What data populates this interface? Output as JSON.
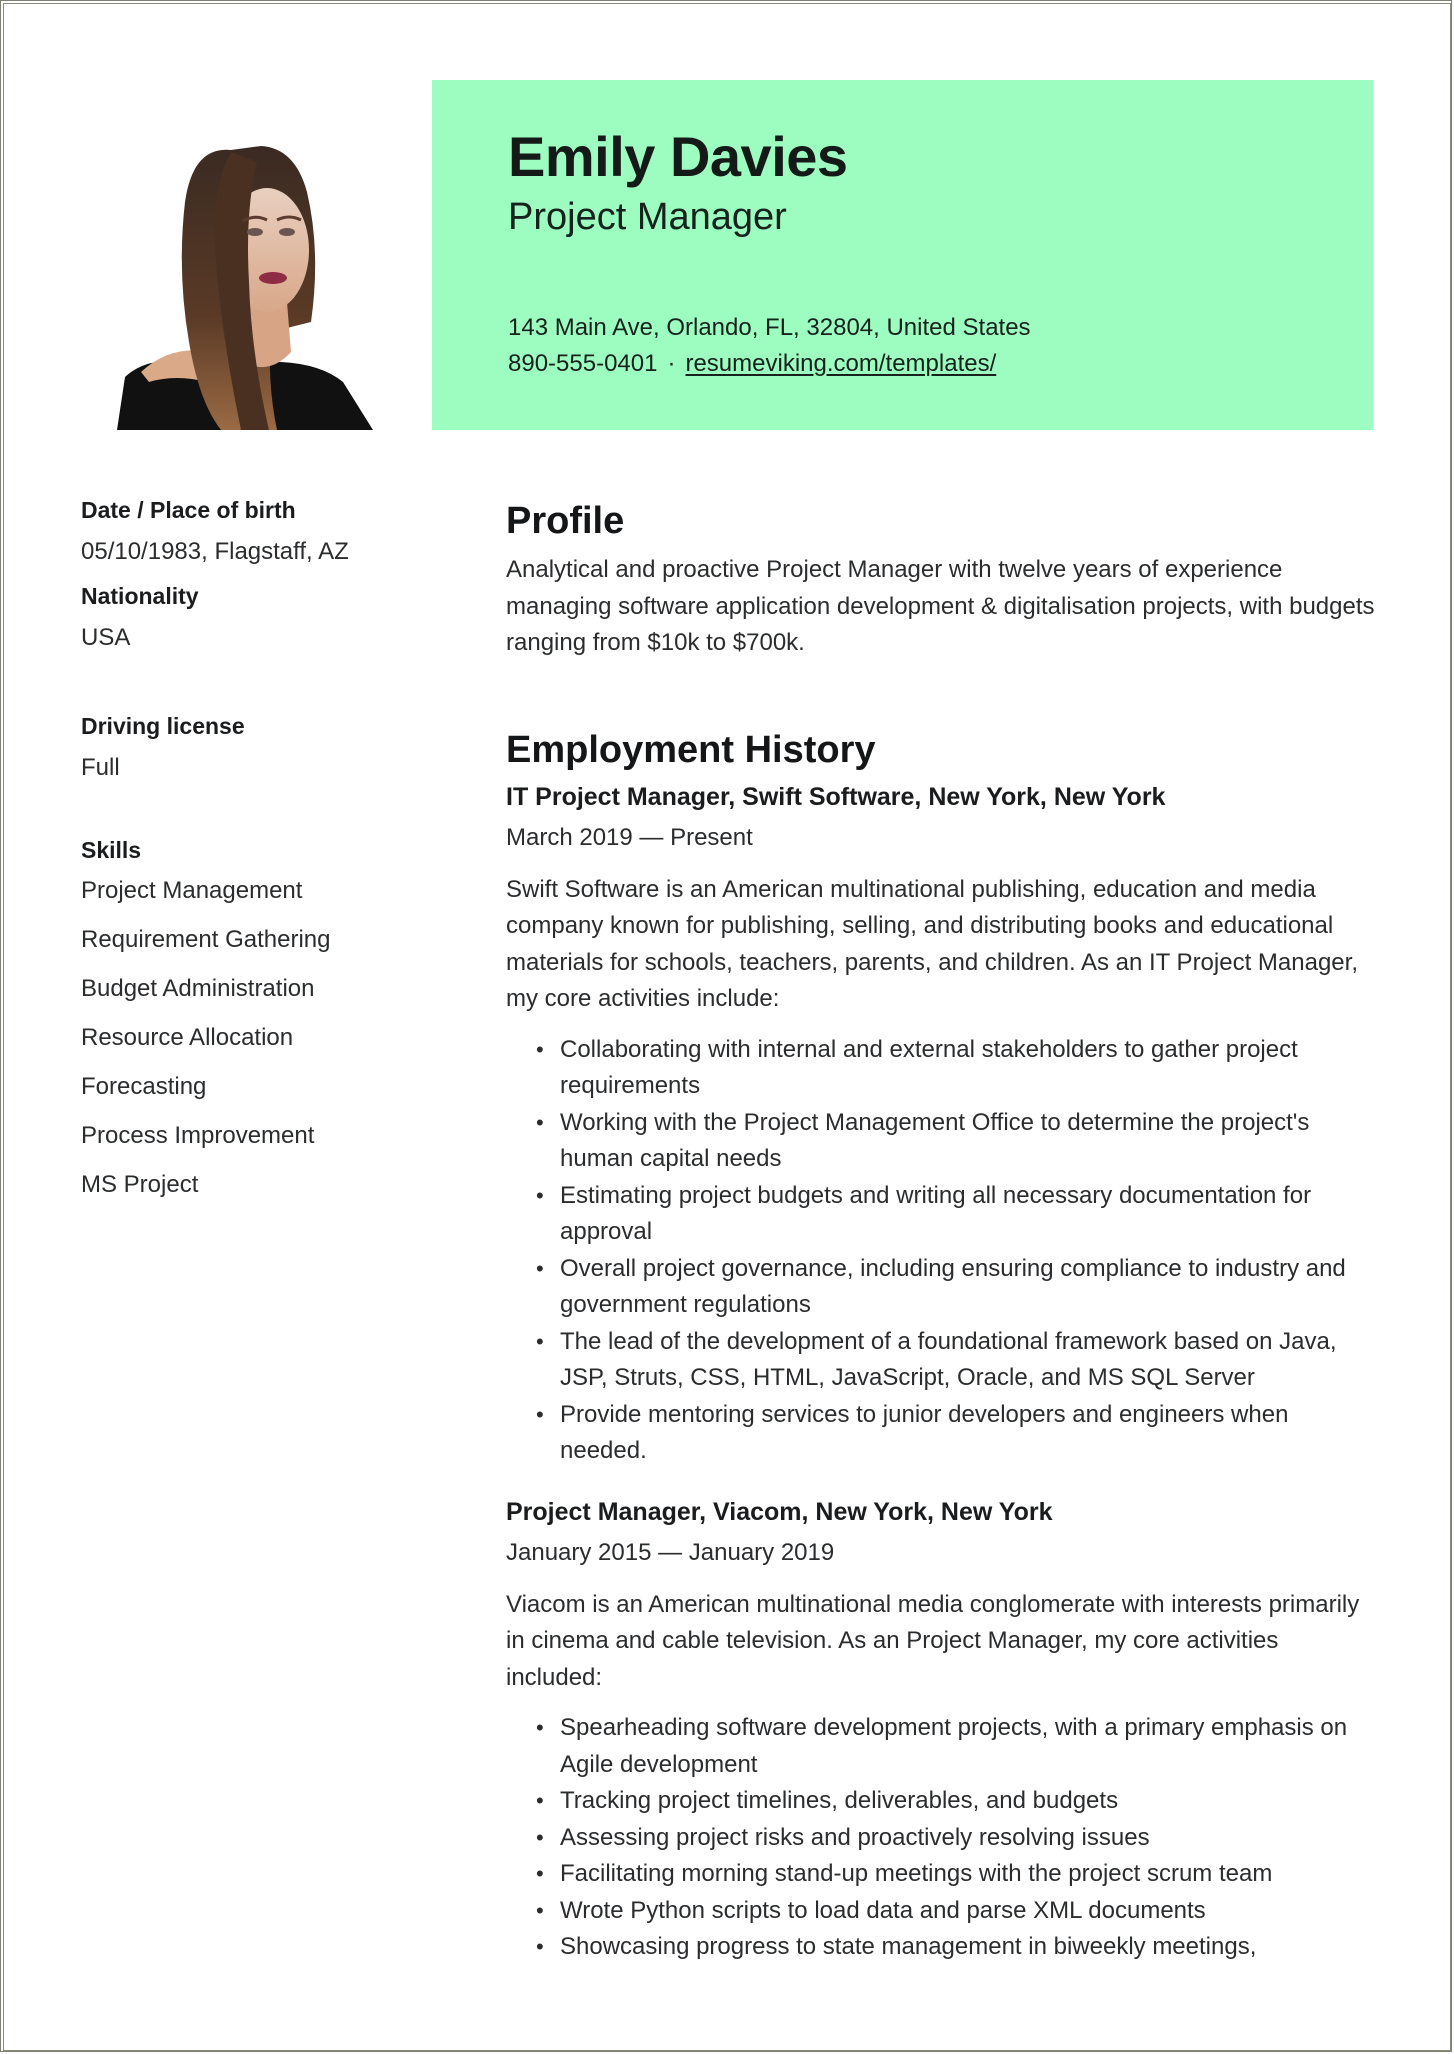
{
  "header": {
    "name": "Emily Davies",
    "role": "Project Manager",
    "address": "143 Main Ave, Orlando, FL, 32804, United States",
    "phone": "890-555-0401",
    "separator": "·",
    "website": "resumeviking.com/templates/",
    "accent_color": "#9dfcbf"
  },
  "photo": {
    "icon": "portrait-photo"
  },
  "sidebar": {
    "details": [
      {
        "label": "Date / Place of birth",
        "value": "05/10/1983, Flagstaff, AZ"
      },
      {
        "label": "Nationality",
        "value": "USA"
      },
      {
        "label": "Driving license",
        "value": "Full"
      }
    ],
    "skills_label": "Skills",
    "skills": [
      "Project Management",
      "Requirement Gathering",
      "Budget Administration",
      "Resource Allocation",
      "Forecasting",
      "Process Improvement",
      "MS Project"
    ]
  },
  "profile": {
    "title": "Profile",
    "text": "Analytical and proactive Project Manager with twelve years of experience managing software application development & digitalisation projects, with budgets ranging from $10k to $700k."
  },
  "employment": {
    "title": "Employment History",
    "jobs": [
      {
        "title": "IT Project Manager, Swift Software, New York, New York",
        "dates": "March 2019 — Present",
        "description": "Swift Software is an American multinational publishing, education and media company known for publishing, selling, and distributing books and educational materials for schools, teachers, parents, and children. As an IT Project Manager, my core activities include:",
        "bullets": [
          "Collaborating with internal and external stakeholders to gather project requirements",
          "Working with the Project Management Office to determine the project's human capital needs",
          "Estimating project budgets and writing all necessary documentation for approval",
          "Overall project governance, including ensuring compliance to industry and government regulations",
          "The lead of the development of a foundational framework based on Java, JSP, Struts, CSS, HTML, JavaScript, Oracle, and MS SQL Server",
          "Provide mentoring services to junior developers and engineers when needed."
        ]
      },
      {
        "title": "Project Manager, Viacom, New York, New York",
        "dates": "January 2015 — January 2019",
        "description": "Viacom is an American multinational media conglomerate with interests primarily in cinema and cable television. As an Project Manager, my core activities included:",
        "bullets": [
          "Spearheading software development projects, with a primary emphasis on Agile development",
          "Tracking project timelines, deliverables, and budgets",
          "Assessing project risks and proactively resolving issues",
          "Facilitating morning stand-up meetings with the project scrum team",
          "Wrote Python scripts to load data and parse XML documents",
          "Showcasing progress to state management in biweekly meetings,"
        ]
      }
    ]
  },
  "bullet_glyph": "•"
}
